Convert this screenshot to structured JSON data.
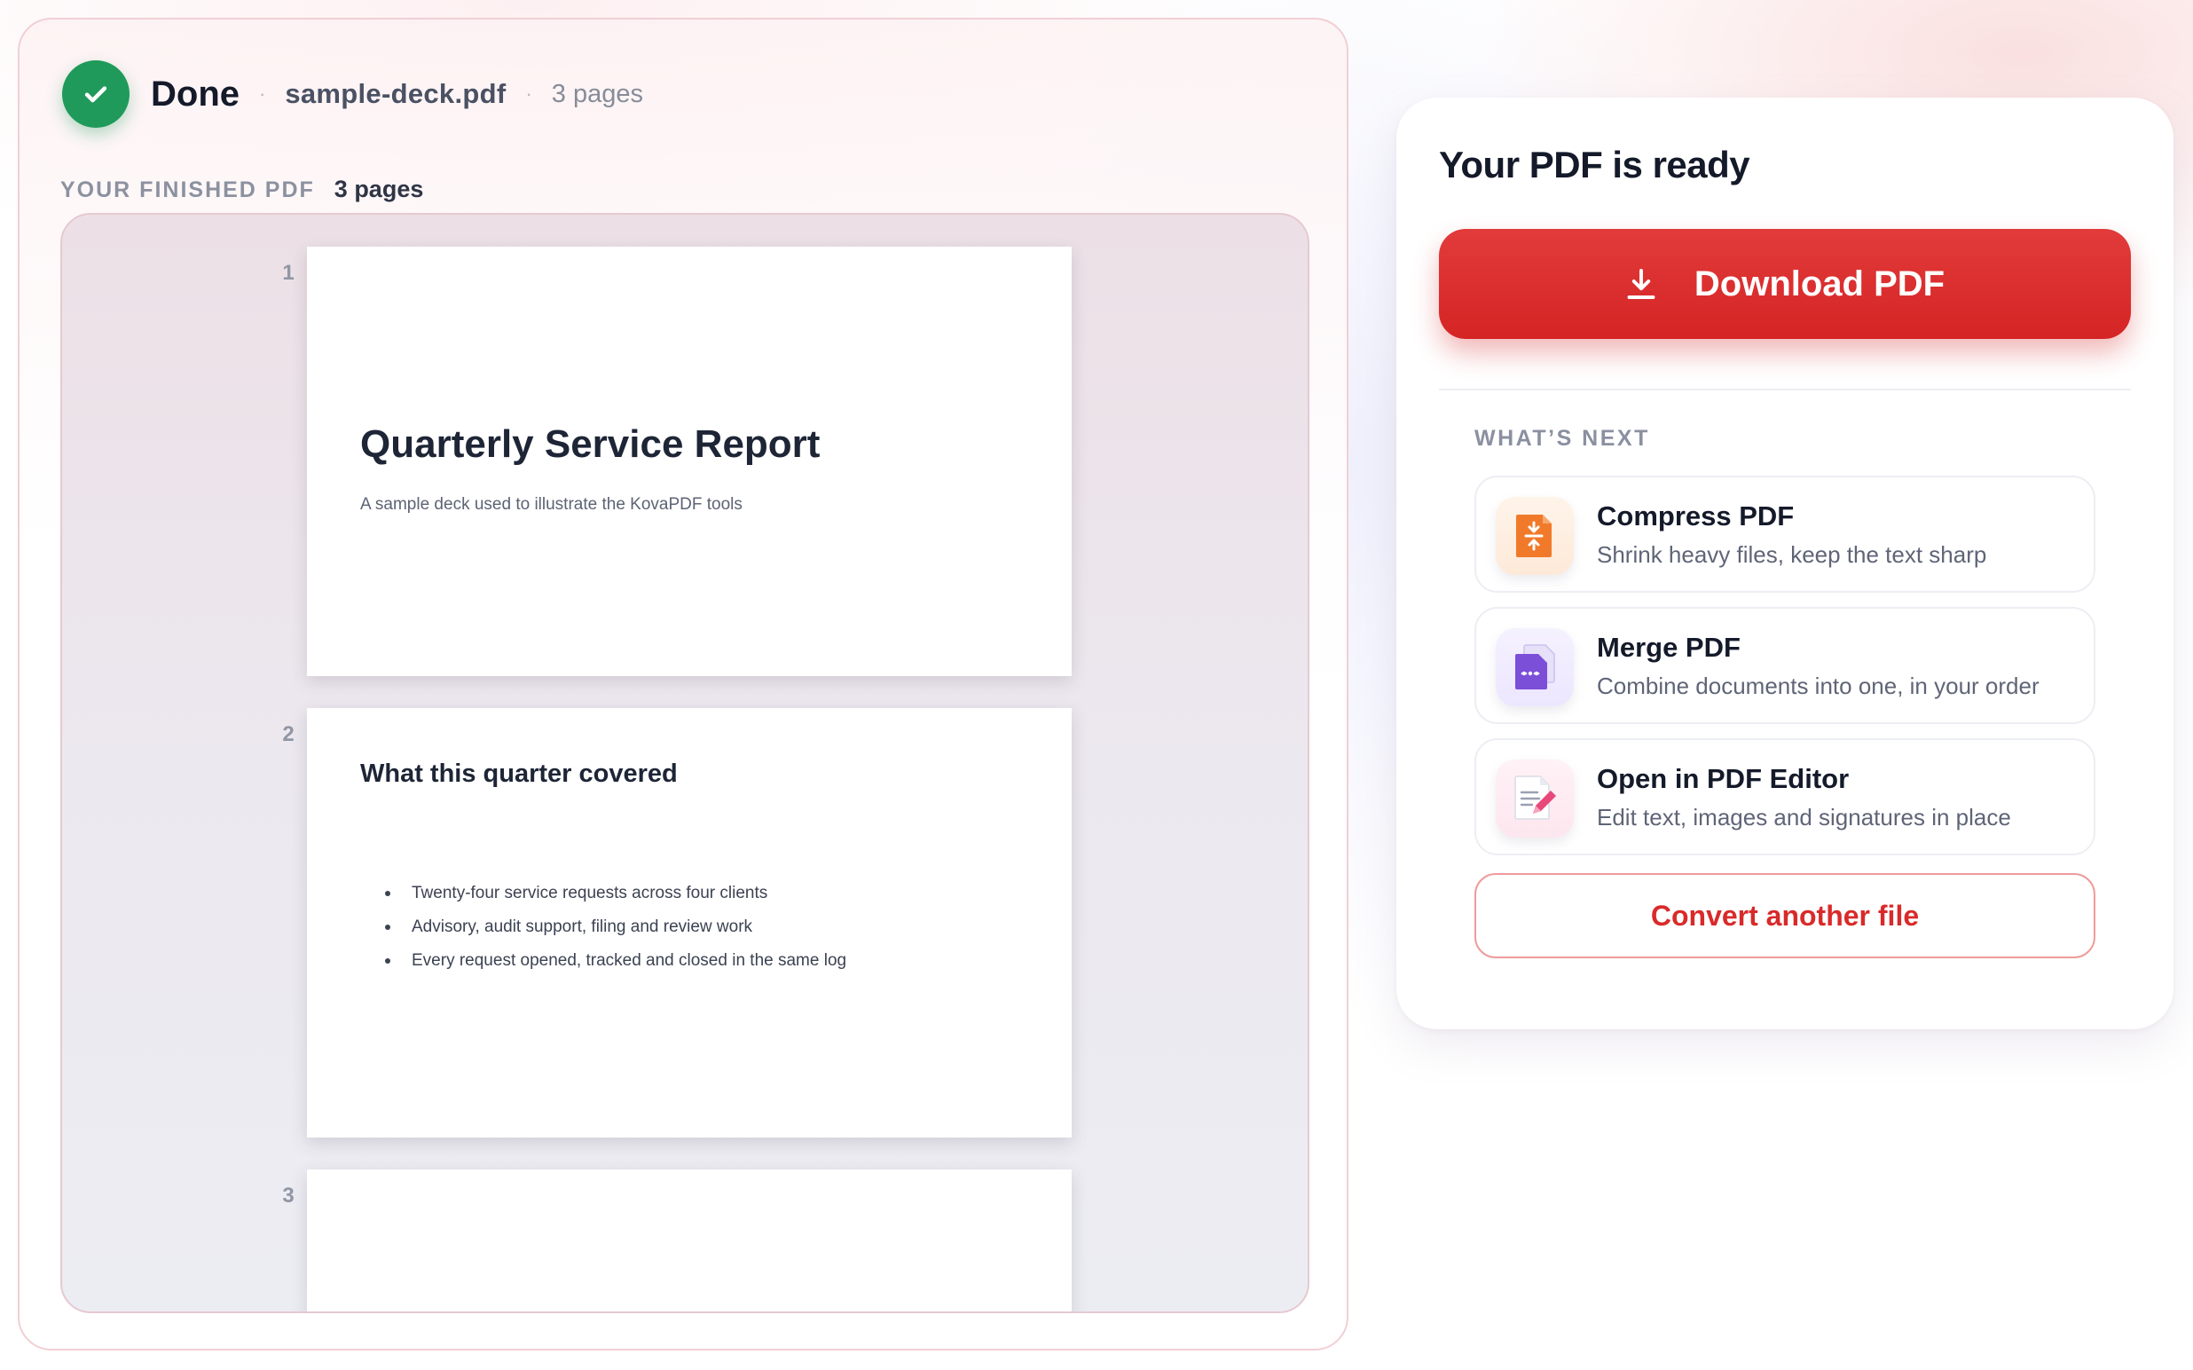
{
  "status": {
    "state_label": "Done",
    "separator": "·",
    "file_name": "sample-deck.pdf",
    "page_count_label": "3 pages"
  },
  "finished": {
    "label": "YOUR FINISHED PDF",
    "count_label": "3 pages"
  },
  "preview": {
    "pages": [
      {
        "number": "1",
        "title": "Quarterly Service Report",
        "subtitle": "A sample deck used to illustrate the KovaPDF tools"
      },
      {
        "number": "2",
        "title": "What this quarter covered",
        "bullets": [
          "Twenty-four service requests across four clients",
          "Advisory, audit support, filing and review work",
          "Every request opened, tracked and closed in the same log"
        ]
      },
      {
        "number": "3"
      }
    ]
  },
  "sidebar": {
    "title": "Your PDF is ready",
    "download_label": "Download PDF",
    "download_icon": "download-icon",
    "next_label": "WHAT’S NEXT",
    "next_items": [
      {
        "icon": "compress-icon",
        "title": "Compress PDF",
        "description": "Shrink heavy files, keep the text sharp"
      },
      {
        "icon": "merge-icon",
        "title": "Merge PDF",
        "description": "Combine documents into one, in your order"
      },
      {
        "icon": "pdf-editor-icon",
        "title": "Open in PDF Editor",
        "description": "Edit text, images and signatures in place"
      }
    ],
    "convert_label": "Convert another file"
  },
  "colors": {
    "accent_red": "#d92a2a",
    "success_green": "#1f9a5a",
    "compress_orange": "#f07a2a",
    "merge_purple": "#7b4fd8",
    "editor_pink": "#e8487a"
  }
}
